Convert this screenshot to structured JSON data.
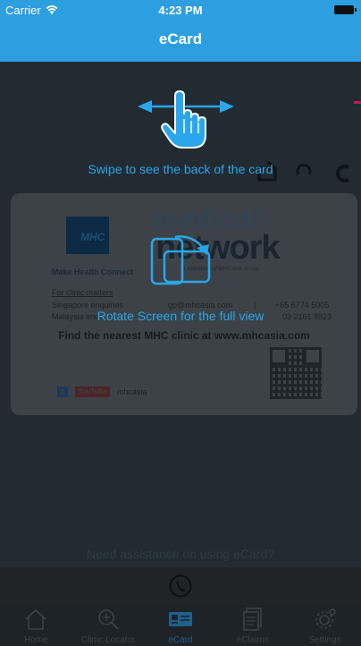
{
  "status_bar": {
    "carrier": "Carrier",
    "time": "4:23 PM"
  },
  "nav": {
    "title": "eCard"
  },
  "overlay": {
    "swipe_hint": "Swipe to see the back of the card",
    "rotate_hint": "Rotate Screen for the full view"
  },
  "card": {
    "logo_text": "MHC",
    "tagline": "Make Health Connect",
    "brand_top": "medical",
    "brand_bottom": "network",
    "subsidiary": "a subsidiary of MHC Asia Group",
    "clinic_matters": "For clinic matters",
    "sg_label": "Singapore enquiries",
    "sg_email": "gp@mhcasia.com",
    "sg_phone": "+65 6774 5005",
    "my_label": "Malaysia enq",
    "my_phone": "03 2161 8823",
    "find_line": "Find the nearest MHC clinic at www.mhcasia.com",
    "fb_glyph": "f",
    "youtube": "YouTube",
    "social_handle": "mhcasia"
  },
  "assist_text": "Need assistance on using eCard?",
  "tabs": [
    {
      "label": "Home",
      "icon": "home-icon"
    },
    {
      "label": "Clinic Locator",
      "icon": "map-search-icon"
    },
    {
      "label": "eCard",
      "icon": "id-card-icon"
    },
    {
      "label": "eClaims",
      "icon": "documents-icon"
    },
    {
      "label": "Settings",
      "icon": "gear-icon"
    }
  ],
  "colors": {
    "accent": "#2d9fe0",
    "hint": "#2aa6ec",
    "overlay_bg": "#222b32"
  }
}
